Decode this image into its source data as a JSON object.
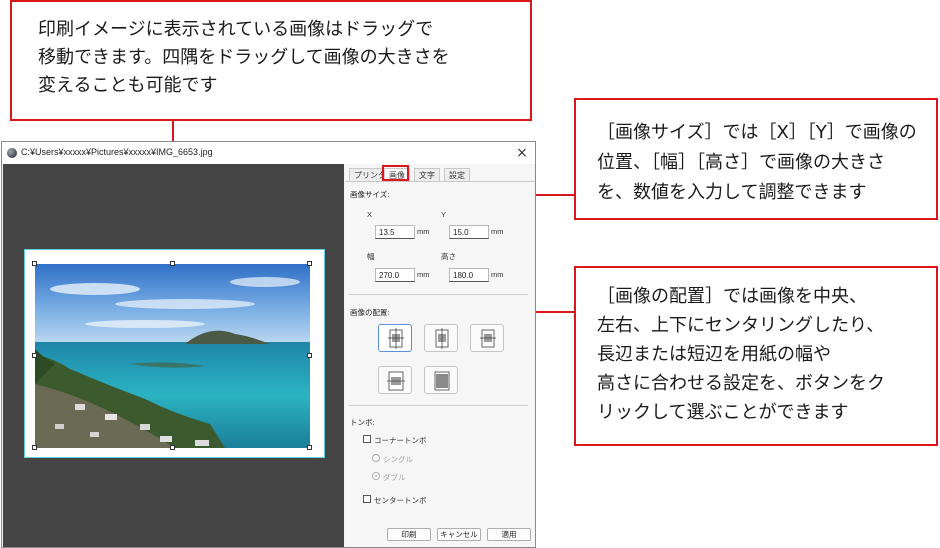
{
  "callouts": {
    "top": {
      "line1": "印刷イメージに表示されている画像はドラッグで",
      "line2": "移動できます。四隅をドラッグして画像の大きさを",
      "line3": "変えることも可能です"
    },
    "size": {
      "line1": "［画像サイズ］では［X］［Y］で画像の",
      "line2": "位置、［幅］［高さ］で画像の大きさ",
      "line3": "を、数値を入力して調整できます"
    },
    "layout": {
      "line1": "［画像の配置］では画像を中央、",
      "line2": "左右、上下にセンタリングしたり、",
      "line3": "長辺または短辺を用紙の幅や",
      "line4": "高さに合わせる設定を、ボタンをク",
      "line5": "リックして選ぶことができます"
    }
  },
  "window": {
    "title": "C:¥Users¥xxxxx¥Pictures¥xxxxx¥IMG_6653.jpg",
    "close": "×"
  },
  "tabs": [
    {
      "label": "プリンタ"
    },
    {
      "label": "画像"
    },
    {
      "label": "文字"
    },
    {
      "label": "設定"
    }
  ],
  "image_size": {
    "label": "画像サイズ:",
    "x_label": "X",
    "y_label": "Y",
    "x_value": "13.5",
    "y_value": "15.0",
    "width_label": "幅",
    "height_label": "高さ",
    "width_value": "270.0",
    "height_value": "180.0",
    "unit": "mm"
  },
  "image_layout": {
    "label": "画像の配置:",
    "buttons": [
      "center",
      "left-right",
      "top-bottom",
      "fit-long-side",
      "fit-short-side"
    ]
  },
  "tombo": {
    "label": "トンボ:",
    "corner": "コーナートンボ",
    "single": "シングル",
    "double": "ダブル",
    "center": "センタートンボ"
  },
  "buttons": {
    "print": "印刷",
    "cancel": "キャンセル",
    "apply": "適用"
  },
  "colors": {
    "callout_border": "#d9161c",
    "paper_border": "#5fd0df",
    "preview_bg": "#444444"
  }
}
